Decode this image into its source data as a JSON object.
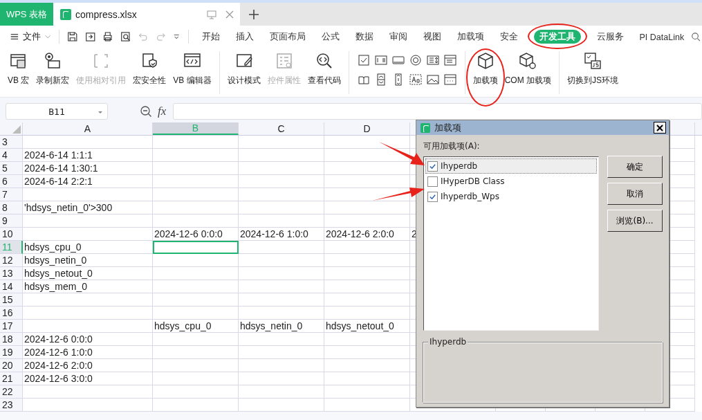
{
  "app_tab": {
    "label": "WPS 表格"
  },
  "document_tab": {
    "title": "compress.xlsx"
  },
  "menu": {
    "file": "文件",
    "tabs": [
      {
        "label": "开始",
        "selected": false,
        "circled": false
      },
      {
        "label": "插入",
        "selected": false,
        "circled": false
      },
      {
        "label": "页面布局",
        "selected": false,
        "circled": false
      },
      {
        "label": "公式",
        "selected": false,
        "circled": false
      },
      {
        "label": "数据",
        "selected": false,
        "circled": false
      },
      {
        "label": "审阅",
        "selected": false,
        "circled": false
      },
      {
        "label": "视图",
        "selected": false,
        "circled": false
      },
      {
        "label": "加载项",
        "selected": false,
        "circled": false
      },
      {
        "label": "安全",
        "selected": false,
        "circled": false
      },
      {
        "label": "开发工具",
        "selected": true,
        "circled": true
      },
      {
        "label": "云服务",
        "selected": false,
        "circled": false
      },
      {
        "label": "PI DataLink",
        "selected": false,
        "circled": false
      }
    ]
  },
  "ribbon": {
    "groups": [
      {
        "kind": "buttons",
        "items": [
          {
            "label": "VB 宏",
            "disabled": false,
            "circled": false
          },
          {
            "label": "录制新宏",
            "disabled": false,
            "circled": false
          },
          {
            "label": "使用相对引用",
            "disabled": true,
            "circled": false
          },
          {
            "label": "宏安全性",
            "disabled": false,
            "circled": false
          },
          {
            "label": "VB 编辑器",
            "disabled": false,
            "circled": false
          }
        ]
      },
      {
        "kind": "buttons",
        "items": [
          {
            "label": "设计模式",
            "disabled": false,
            "circled": false
          },
          {
            "label": "控件属性",
            "disabled": true,
            "circled": false
          },
          {
            "label": "查看代码",
            "disabled": false,
            "circled": false
          }
        ]
      },
      {
        "kind": "control_icons"
      },
      {
        "kind": "buttons",
        "items": [
          {
            "label": "加载项",
            "disabled": false,
            "circled": true
          },
          {
            "label": "COM 加载项",
            "disabled": false,
            "circled": false
          }
        ]
      },
      {
        "kind": "buttons",
        "items": [
          {
            "label": "切换到JS环境",
            "disabled": false,
            "circled": false
          }
        ]
      }
    ]
  },
  "formula_bar": {
    "name_box": "B11",
    "fx": "fx"
  },
  "sheet": {
    "columns": [
      {
        "label": "A",
        "selected": false
      },
      {
        "label": "B",
        "selected": true
      },
      {
        "label": "C",
        "selected": false
      },
      {
        "label": "D",
        "selected": false
      }
    ],
    "rows": [
      {
        "number": "3",
        "selected": false
      },
      {
        "number": "4",
        "selected": false,
        "a": "2024-6-14 1:1:1"
      },
      {
        "number": "5",
        "selected": false,
        "a": "2024-6-14 1:30:1"
      },
      {
        "number": "6",
        "selected": false,
        "a": "2024-6-14 2:2:1"
      },
      {
        "number": "7",
        "selected": false
      },
      {
        "number": "8",
        "selected": false,
        "a": "'hdsys_netin_0'>300"
      },
      {
        "number": "9",
        "selected": false
      },
      {
        "number": "10",
        "selected": false,
        "b": "2024-12-6 0:0:0",
        "c": "2024-12-6 1:0:0",
        "d": "2024-12-6 2:0:0",
        "e": "2"
      },
      {
        "number": "11",
        "selected": true,
        "a": "hdsys_cpu_0"
      },
      {
        "number": "12",
        "selected": false,
        "a": "hdsys_netin_0"
      },
      {
        "number": "13",
        "selected": false,
        "a": "hdsys_netout_0"
      },
      {
        "number": "14",
        "selected": false,
        "a": "hdsys_mem_0"
      },
      {
        "number": "15",
        "selected": false
      },
      {
        "number": "16",
        "selected": false
      },
      {
        "number": "17",
        "selected": false,
        "b": "hdsys_cpu_0",
        "c": "hdsys_netin_0",
        "d": "hdsys_netout_0"
      },
      {
        "number": "18",
        "selected": false,
        "a": "2024-12-6 0:0:0"
      },
      {
        "number": "19",
        "selected": false,
        "a": "2024-12-6 1:0:0"
      },
      {
        "number": "20",
        "selected": false,
        "a": "2024-12-6 2:0:0"
      },
      {
        "number": "21",
        "selected": false,
        "a": "2024-12-6 3:0:0"
      },
      {
        "number": "22",
        "selected": false
      },
      {
        "number": "23",
        "selected": false
      }
    ]
  },
  "dialog": {
    "title": "加载项",
    "list_label": "可用加载项(A):",
    "items": [
      {
        "label": "Ihyperdb",
        "checked": true,
        "selected": true,
        "arrow": true
      },
      {
        "label": "IHyperDB Class",
        "checked": false,
        "selected": false,
        "arrow": false
      },
      {
        "label": "Ihyperdb_Wps",
        "checked": true,
        "selected": false,
        "arrow": true
      }
    ],
    "buttons": [
      "确定",
      "取消",
      "浏览(B)..."
    ],
    "group_title": "Ihyperdb"
  }
}
